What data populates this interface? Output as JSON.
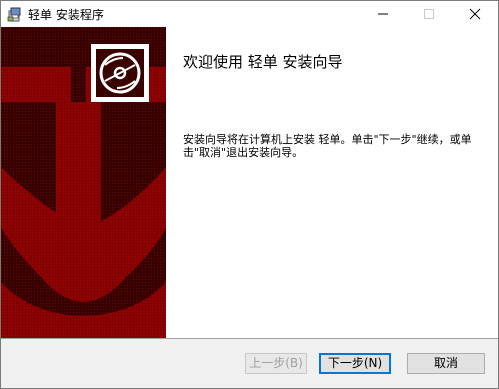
{
  "window": {
    "title": "轻单 安装程序"
  },
  "welcome": {
    "heading": "欢迎使用 轻单 安装向导",
    "description": "安装向导将在计算机上安装 轻单。单击\"下一步\"继续，或单击\"取消\"退出安装向导。"
  },
  "buttons": {
    "back": "上一步(B)",
    "next": "下一步(N)",
    "cancel": "取消"
  },
  "colors": {
    "banner_dark": "#3a0000",
    "banner_red": "#8b0000",
    "accent": "#0078d7"
  },
  "icons": {
    "app": "installer-package-icon",
    "logo": "disc-icon"
  }
}
